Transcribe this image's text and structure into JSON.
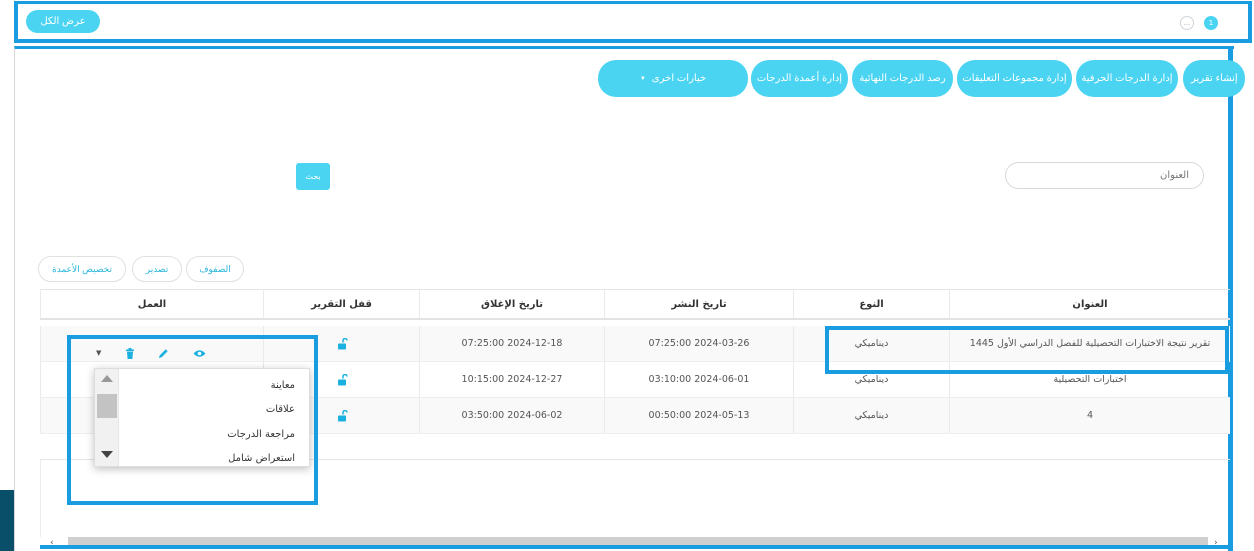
{
  "topbar": {
    "show_all": "عرض الكل",
    "pager_more": "...",
    "pager_current": "1"
  },
  "nav": {
    "create_report": "إنشاء تقرير",
    "letter_grades": "إدارة الدرجات الحرفية",
    "comment_groups": "إدارة مجموعات التعليقات",
    "final_grades": "رصد الدرجات النهائية",
    "grade_columns": "إدارة أعمدة الدرجات",
    "other_options": "خيارات اخرى"
  },
  "search": {
    "placeholder": "العنوان",
    "button": "بحث"
  },
  "table_tools": {
    "rows": "الصفوف",
    "export": "تصدير",
    "customize_columns": "تخصيص الأعمدة"
  },
  "table": {
    "headers": {
      "title": "العنوان",
      "type": "النوع",
      "publish_date": "تاريخ النشر",
      "close_date": "تاريخ الإغلاق",
      "lock": "قفل التقرير",
      "action": "العمل"
    },
    "rows": [
      {
        "title": "تقرير نتيجة الاختبارات التحصيلية للفصل الدراسي الأول 1445",
        "type": "ديناميكي",
        "publish_date": "07:25:00 2024-03-26",
        "close_date": "07:25:00 2024-12-18"
      },
      {
        "title": "اختبارات التحصيلية",
        "type": "ديناميكي",
        "publish_date": "03:10:00 2024-06-01",
        "close_date": "10:15:00 2024-12-27"
      },
      {
        "title": "4",
        "type": "ديناميكي",
        "publish_date": "00:50:00 2024-05-13",
        "close_date": "03:50:00 2024-06-02"
      }
    ]
  },
  "dropdown": {
    "items": [
      "معاينة",
      "علاقات",
      "مراجعة الدرجات",
      "استعراض شامل"
    ]
  },
  "icons": {
    "lock": "unlock-icon",
    "view": "eye-icon",
    "edit": "pencil-icon",
    "delete": "trash-icon"
  },
  "colors": {
    "accent": "#4ad4f2",
    "highlight": "#1a9de0"
  }
}
